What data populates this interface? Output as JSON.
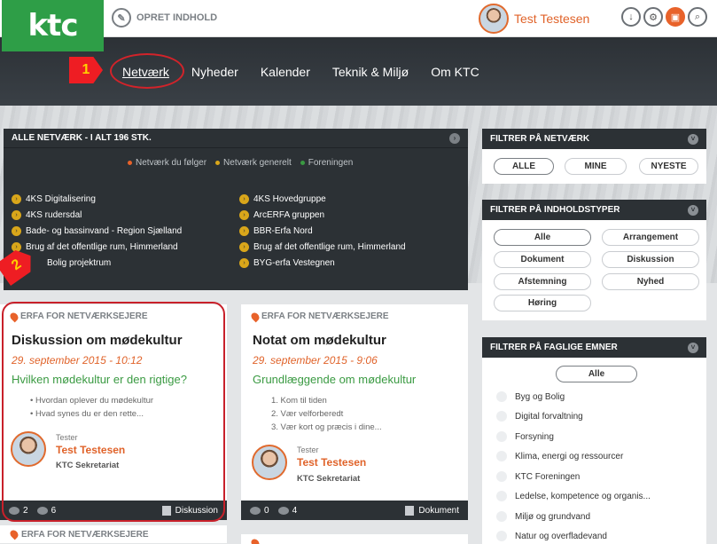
{
  "header": {
    "logo": "ktc",
    "create_label": "OPRET INDHOLD",
    "user_name": "Test Testesen"
  },
  "nav": {
    "items": [
      "Netværk",
      "Nyheder",
      "Kalender",
      "Teknik & Miljø",
      "Om KTC"
    ]
  },
  "annotations": {
    "flag1": "1",
    "flag2": "2"
  },
  "networks": {
    "title": "ALLE NETVÆRK - I ALT 196 STK.",
    "legend": [
      {
        "label": "Netværk du følger",
        "color": "#e8622a"
      },
      {
        "label": "Netværk generelt",
        "color": "#d9a61a"
      },
      {
        "label": "Foreningen",
        "color": "#3a9a42"
      }
    ],
    "left": [
      "4KS Digitalisering",
      "4KS rudersdal",
      "Bade- og bassinvand - Region Sjælland",
      "Brug af det offentlige rum, Himmerland",
      "Bolig projektrum"
    ],
    "right": [
      "4KS Hovedgruppe",
      "ArcERFA gruppen",
      "BBR-Erfa Nord",
      "Brug af det offentlige rum, Himmerland",
      "BYG-erfa Vestegnen"
    ]
  },
  "filter_network": {
    "title": "FILTRER PÅ NETVÆRK",
    "options": [
      "ALLE",
      "MINE",
      "NYESTE"
    ]
  },
  "filter_content": {
    "title": "FILTRER PÅ INDHOLDSTYPER",
    "options": [
      "Alle",
      "Arrangement",
      "Dokument",
      "Diskussion",
      "Afstemning",
      "Nyhed",
      "Høring"
    ]
  },
  "filter_topics": {
    "title": "FILTRER PÅ FAGLIGE EMNER",
    "all": "Alle",
    "items": [
      "Byg og Bolig",
      "Digital forvaltning",
      "Forsyning",
      "Klima, energi og ressourcer",
      "KTC Foreningen",
      "Ledelse, kompetence og organis...",
      "Miljø og grundvand",
      "Natur og overfladevand"
    ]
  },
  "cards": [
    {
      "category": "ERFA FOR NETVÆRKSEJERE",
      "title": "Diskussion om mødekultur",
      "date": "29. september 2015 - 10:12",
      "subtitle": "Hvilken mødekultur er den rigtige?",
      "list": [
        "Hvordan oplever du mødekultur",
        "Hvad synes du er den rette..."
      ],
      "author_role": "Tester",
      "author": "Test Testesen",
      "org": "KTC Sekretariat",
      "comments": "2",
      "views": "6",
      "type": "Diskussion"
    },
    {
      "category": "ERFA FOR NETVÆRKSEJERE",
      "title": "Notat om mødekultur",
      "date": "29. september 2015 - 9:06",
      "subtitle": "Grundlæggende om mødekultur",
      "list": [
        "1. Kom til tiden",
        "2. Vær velforberedt",
        "3. Vær kort og præcis i dine..."
      ],
      "author_role": "Tester",
      "author": "Test Testesen",
      "org": "KTC Sekretariat",
      "comments": "0",
      "views": "4",
      "type": "Dokument"
    }
  ],
  "card_stub": "ERFA FOR NETVÆRKSEJERE"
}
